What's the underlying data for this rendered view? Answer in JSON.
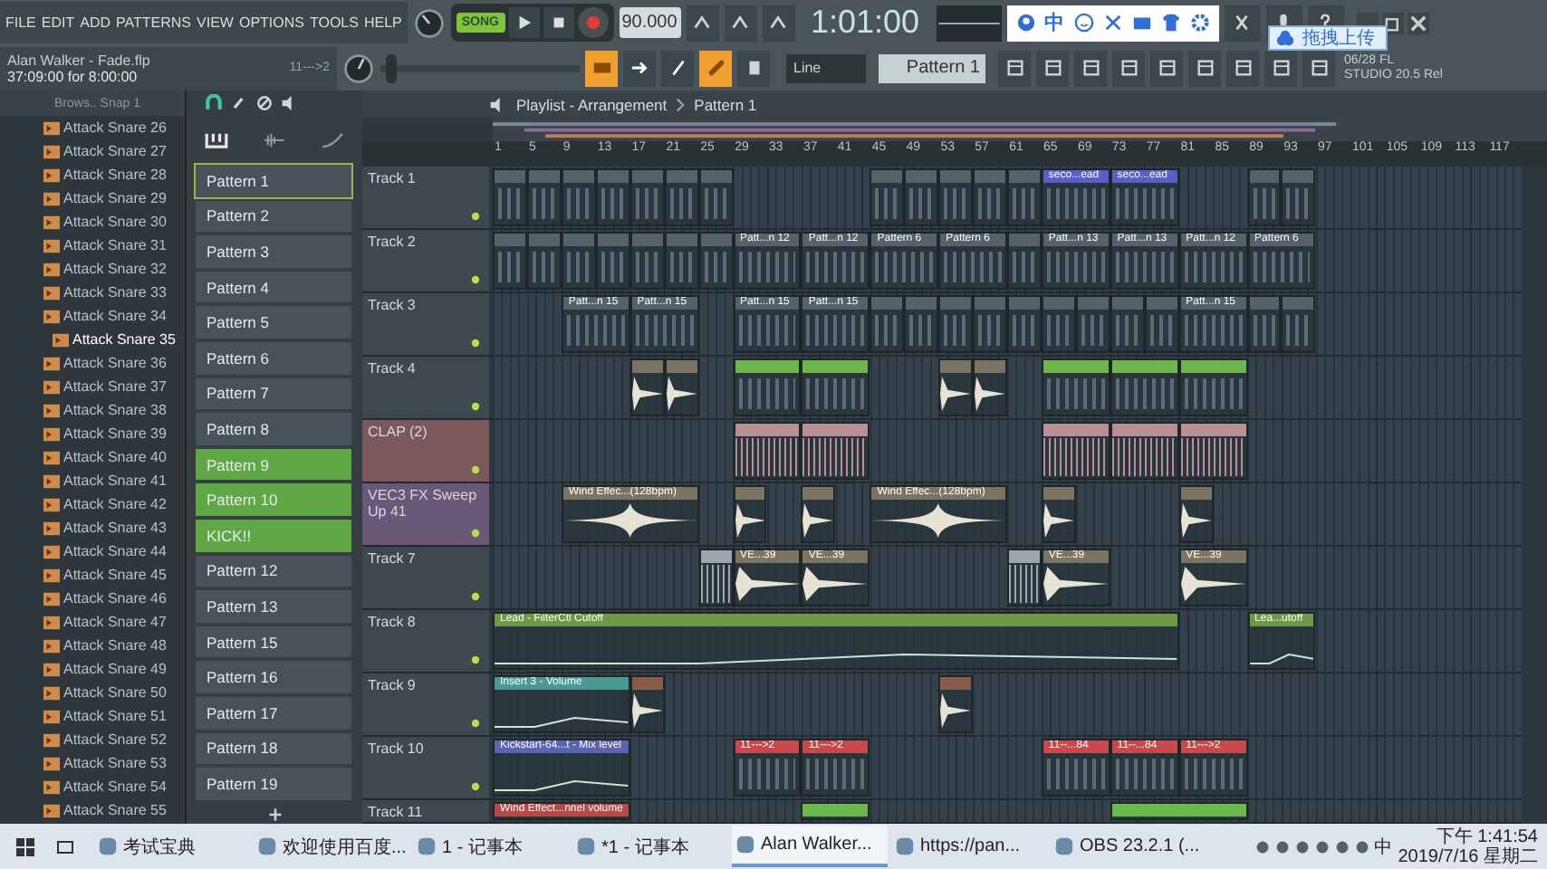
{
  "menu": [
    "FILE",
    "EDIT",
    "ADD",
    "PATTERNS",
    "VIEW",
    "OPTIONS",
    "TOOLS",
    "HELP"
  ],
  "song_info": {
    "title": "Alan Walker - Fade.flp",
    "position": "37:09:00 for 8:00:00",
    "hint": "11--->2"
  },
  "transport": {
    "mode": "SONG"
  },
  "tempo": "90.000",
  "time": "1:01:00",
  "pitch_slider": {
    "level": 0.03
  },
  "snap": "Line",
  "pattern_selector": "Pattern 1",
  "ime_toolbar": {
    "label": "中"
  },
  "upload_tooltip": "拖拽上传",
  "version": {
    "date": "06/28",
    "product": "FL",
    "build": "STUDIO 20.5 Rel"
  },
  "browser": {
    "header": "Brows.. Snap 1",
    "items": [
      {
        "label": "Attack Snare 26",
        "selected": false
      },
      {
        "label": "Attack Snare 27",
        "selected": false
      },
      {
        "label": "Attack Snare 28",
        "selected": false
      },
      {
        "label": "Attack Snare 29",
        "selected": false
      },
      {
        "label": "Attack Snare 30",
        "selected": false
      },
      {
        "label": "Attack Snare 31",
        "selected": false
      },
      {
        "label": "Attack Snare 32",
        "selected": false
      },
      {
        "label": "Attack Snare 33",
        "selected": false
      },
      {
        "label": "Attack Snare 34",
        "selected": false
      },
      {
        "label": "Attack Snare 35",
        "selected": true
      },
      {
        "label": "Attack Snare 36",
        "selected": false
      },
      {
        "label": "Attack Snare 37",
        "selected": false
      },
      {
        "label": "Attack Snare 38",
        "selected": false
      },
      {
        "label": "Attack Snare 39",
        "selected": false
      },
      {
        "label": "Attack Snare 40",
        "selected": false
      },
      {
        "label": "Attack Snare 41",
        "selected": false
      },
      {
        "label": "Attack Snare 42",
        "selected": false
      },
      {
        "label": "Attack Snare 43",
        "selected": false
      },
      {
        "label": "Attack Snare 44",
        "selected": false
      },
      {
        "label": "Attack Snare 45",
        "selected": false
      },
      {
        "label": "Attack Snare 46",
        "selected": false
      },
      {
        "label": "Attack Snare 47",
        "selected": false
      },
      {
        "label": "Attack Snare 48",
        "selected": false
      },
      {
        "label": "Attack Snare 49",
        "selected": false
      },
      {
        "label": "Attack Snare 50",
        "selected": false
      },
      {
        "label": "Attack Snare 51",
        "selected": false
      },
      {
        "label": "Attack Snare 52",
        "selected": false
      },
      {
        "label": "Attack Snare 53",
        "selected": false
      },
      {
        "label": "Attack Snare 54",
        "selected": false
      },
      {
        "label": "Attack Snare 55",
        "selected": false
      }
    ]
  },
  "patterns": [
    {
      "label": "Pattern 1",
      "selected": true,
      "color": "#48525a"
    },
    {
      "label": "Pattern 2",
      "selected": false,
      "color": "#48525a"
    },
    {
      "label": "Pattern 3",
      "selected": false,
      "color": "#48525a"
    },
    {
      "label": "Pattern 4",
      "selected": false,
      "color": "#48525a"
    },
    {
      "label": "Pattern 5",
      "selected": false,
      "color": "#48525a"
    },
    {
      "label": "Pattern 6",
      "selected": false,
      "color": "#48525a"
    },
    {
      "label": "Pattern 7",
      "selected": false,
      "color": "#48525a"
    },
    {
      "label": "Pattern 8",
      "selected": false,
      "color": "#48525a"
    },
    {
      "label": "Pattern 9",
      "selected": false,
      "color": "#5fa845"
    },
    {
      "label": "Pattern 10",
      "selected": false,
      "color": "#5fa845"
    },
    {
      "label": "KICK!!",
      "selected": false,
      "color": "#5fa845"
    },
    {
      "label": "Pattern 12",
      "selected": false,
      "color": "#48525a"
    },
    {
      "label": "Pattern 13",
      "selected": false,
      "color": "#48525a"
    },
    {
      "label": "Pattern 15",
      "selected": false,
      "color": "#48525a"
    },
    {
      "label": "Pattern 16",
      "selected": false,
      "color": "#48525a"
    },
    {
      "label": "Pattern 17",
      "selected": false,
      "color": "#48525a"
    },
    {
      "label": "Pattern 18",
      "selected": false,
      "color": "#48525a"
    },
    {
      "label": "Pattern 19",
      "selected": false,
      "color": "#48525a"
    }
  ],
  "playlist": {
    "title": "Playlist - Arrangement",
    "pattern": "Pattern 1",
    "ruler": [
      "1",
      "5",
      "9",
      "13",
      "17",
      "21",
      "25",
      "29",
      "33",
      "37",
      "41",
      "45",
      "49",
      "53",
      "57",
      "61",
      "65",
      "69",
      "73",
      "77",
      "81",
      "85",
      "89",
      "93",
      "97",
      "101",
      "105",
      "109",
      "113",
      "117"
    ],
    "tracks": [
      {
        "name": "Track 1",
        "color": "#3f484e",
        "cells": [
          {
            "kind": "pattern"
          },
          {
            "kind": "pattern"
          },
          {
            "kind": "pattern"
          },
          {
            "kind": "pattern"
          },
          {
            "kind": "pattern"
          },
          {
            "kind": "pattern"
          },
          {
            "kind": "pattern"
          },
          {
            "kind": "gap"
          },
          {
            "kind": "gap"
          },
          {
            "kind": "gap"
          },
          {
            "kind": "gap"
          },
          {
            "kind": "pattern"
          },
          {
            "kind": "pattern"
          },
          {
            "kind": "pattern"
          },
          {
            "kind": "pattern"
          },
          {
            "kind": "pattern"
          },
          {
            "kind": "pattern",
            "label": "seco...ead",
            "color": "#5a5fc8"
          },
          {
            "kind": "continue"
          },
          {
            "kind": "pattern",
            "label": "seco...ead",
            "color": "#5a5fc8"
          },
          {
            "kind": "continue"
          },
          {
            "kind": "gap"
          },
          {
            "kind": "gap"
          },
          {
            "kind": "pattern"
          },
          {
            "kind": "pattern"
          }
        ]
      },
      {
        "name": "Track 2",
        "color": "#3f484e",
        "cells": [
          {
            "kind": "pattern"
          },
          {
            "kind": "pattern"
          },
          {
            "kind": "pattern"
          },
          {
            "kind": "pattern"
          },
          {
            "kind": "pattern"
          },
          {
            "kind": "pattern"
          },
          {
            "kind": "pattern"
          },
          {
            "kind": "pattern",
            "label": "Patt...n 12"
          },
          {
            "kind": "continue"
          },
          {
            "kind": "pattern",
            "label": "Patt...n 12"
          },
          {
            "kind": "continue"
          },
          {
            "kind": "pattern",
            "label": "Pattern 6"
          },
          {
            "kind": "continue"
          },
          {
            "kind": "pattern",
            "label": "Pattern 6"
          },
          {
            "kind": "continue"
          },
          {
            "kind": "pattern"
          },
          {
            "kind": "pattern",
            "label": "Patt...n 13"
          },
          {
            "kind": "continue"
          },
          {
            "kind": "pattern",
            "label": "Patt...n 13"
          },
          {
            "kind": "continue"
          },
          {
            "kind": "pattern",
            "label": "Patt...n 12"
          },
          {
            "kind": "continue"
          },
          {
            "kind": "pattern",
            "label": "Pattern 6"
          },
          {
            "kind": "continue"
          }
        ]
      },
      {
        "name": "Track 3",
        "color": "#3f484e",
        "cells": [
          {
            "kind": "gap"
          },
          {
            "kind": "gap"
          },
          {
            "kind": "pattern",
            "label": "Patt...n 15"
          },
          {
            "kind": "continue"
          },
          {
            "kind": "pattern",
            "label": "Patt...n 15"
          },
          {
            "kind": "continue"
          },
          {
            "kind": "gap"
          },
          {
            "kind": "pattern",
            "label": "Patt...n 15"
          },
          {
            "kind": "continue"
          },
          {
            "kind": "pattern",
            "label": "Patt...n 15"
          },
          {
            "kind": "continue"
          },
          {
            "kind": "pattern"
          },
          {
            "kind": "pattern"
          },
          {
            "kind": "pattern"
          },
          {
            "kind": "pattern"
          },
          {
            "kind": "pattern"
          },
          {
            "kind": "pattern"
          },
          {
            "kind": "pattern"
          },
          {
            "kind": "pattern"
          },
          {
            "kind": "pattern"
          },
          {
            "kind": "pattern",
            "label": "Patt...n 15"
          },
          {
            "kind": "continue"
          },
          {
            "kind": "pattern"
          },
          {
            "kind": "pattern"
          }
        ]
      },
      {
        "name": "Track 4",
        "color": "#3f484e",
        "cells": [
          {
            "kind": "gap"
          },
          {
            "kind": "gap"
          },
          {
            "kind": "gap"
          },
          {
            "kind": "gap"
          },
          {
            "kind": "sample"
          },
          {
            "kind": "sample"
          },
          {
            "kind": "gap"
          },
          {
            "kind": "pattern",
            "color": "#6cb84a"
          },
          {
            "kind": "continue"
          },
          {
            "kind": "pattern",
            "color": "#6cb84a"
          },
          {
            "kind": "continue"
          },
          {
            "kind": "gap"
          },
          {
            "kind": "gap"
          },
          {
            "kind": "sample"
          },
          {
            "kind": "sample"
          },
          {
            "kind": "gap"
          },
          {
            "kind": "pattern",
            "color": "#6cb84a"
          },
          {
            "kind": "continue"
          },
          {
            "kind": "pattern",
            "color": "#6cb84a"
          },
          {
            "kind": "continue"
          },
          {
            "kind": "pattern",
            "color": "#6cb84a"
          },
          {
            "kind": "continue"
          }
        ]
      },
      {
        "name": "CLAP (2)",
        "color": "#7a585c",
        "cells": [
          {
            "kind": "gap"
          },
          {
            "kind": "gap"
          },
          {
            "kind": "gap"
          },
          {
            "kind": "gap"
          },
          {
            "kind": "gap"
          },
          {
            "kind": "gap"
          },
          {
            "kind": "gap"
          },
          {
            "kind": "dense",
            "color": "#b98f96"
          },
          {
            "kind": "continue"
          },
          {
            "kind": "dense",
            "color": "#b98f96"
          },
          {
            "kind": "continue"
          },
          {
            "kind": "gap"
          },
          {
            "kind": "gap"
          },
          {
            "kind": "gap"
          },
          {
            "kind": "gap"
          },
          {
            "kind": "gap"
          },
          {
            "kind": "dense",
            "color": "#b98f96"
          },
          {
            "kind": "continue"
          },
          {
            "kind": "dense",
            "color": "#b98f96"
          },
          {
            "kind": "continue"
          },
          {
            "kind": "dense",
            "color": "#b98f96"
          },
          {
            "kind": "continue"
          }
        ]
      },
      {
        "name": "VEC3 FX Sweep Up 41",
        "color": "#6a5878",
        "cells": [
          {
            "kind": "gap"
          },
          {
            "kind": "gap"
          },
          {
            "kind": "swell",
            "label": "Wind Effec...(128bpm)"
          },
          {
            "kind": "continue"
          },
          {
            "kind": "continue"
          },
          {
            "kind": "continue"
          },
          {
            "kind": "gap"
          },
          {
            "kind": "sample"
          },
          {
            "kind": "gap"
          },
          {
            "kind": "sample"
          },
          {
            "kind": "gap"
          },
          {
            "kind": "swell",
            "label": "Wind Effec...(128bpm)"
          },
          {
            "kind": "continue"
          },
          {
            "kind": "continue"
          },
          {
            "kind": "continue"
          },
          {
            "kind": "gap"
          },
          {
            "kind": "sample"
          },
          {
            "kind": "gap"
          },
          {
            "kind": "gap"
          },
          {
            "kind": "gap"
          },
          {
            "kind": "sample"
          }
        ]
      },
      {
        "name": "Track 7",
        "color": "#3f484e",
        "cells": [
          {
            "kind": "gap"
          },
          {
            "kind": "gap"
          },
          {
            "kind": "gap"
          },
          {
            "kind": "gap"
          },
          {
            "kind": "gap"
          },
          {
            "kind": "gap"
          },
          {
            "kind": "dense",
            "color": "#9aa7ae"
          },
          {
            "kind": "sample",
            "label": "VE...39"
          },
          {
            "kind": "continue"
          },
          {
            "kind": "sample",
            "label": "VE...39"
          },
          {
            "kind": "continue"
          },
          {
            "kind": "gap"
          },
          {
            "kind": "gap"
          },
          {
            "kind": "gap"
          },
          {
            "kind": "gap"
          },
          {
            "kind": "dense",
            "color": "#9aa7ae"
          },
          {
            "kind": "sample",
            "label": "VE...39"
          },
          {
            "kind": "continue"
          },
          {
            "kind": "gap"
          },
          {
            "kind": "gap"
          },
          {
            "kind": "sample",
            "label": "VE...39"
          },
          {
            "kind": "continue"
          }
        ]
      },
      {
        "name": "Track 8",
        "color": "#3f484e",
        "cells": [
          {
            "kind": "automation",
            "label": "Lead - FilterCtl Cutoff",
            "color": "#6e9a48"
          },
          {
            "kind": "continue"
          },
          {
            "kind": "continue"
          },
          {
            "kind": "continue"
          },
          {
            "kind": "continue"
          },
          {
            "kind": "continue"
          },
          {
            "kind": "continue"
          },
          {
            "kind": "continue"
          },
          {
            "kind": "continue"
          },
          {
            "kind": "continue"
          },
          {
            "kind": "continue"
          },
          {
            "kind": "continue"
          },
          {
            "kind": "continue"
          },
          {
            "kind": "continue"
          },
          {
            "kind": "continue"
          },
          {
            "kind": "continue"
          },
          {
            "kind": "continue"
          },
          {
            "kind": "continue"
          },
          {
            "kind": "continue"
          },
          {
            "kind": "continue"
          },
          {
            "kind": "gap"
          },
          {
            "kind": "gap"
          },
          {
            "kind": "automation",
            "label": "Lea...utoff",
            "color": "#6e9a48"
          },
          {
            "kind": "continue"
          }
        ]
      },
      {
        "name": "Track 9",
        "color": "#3f484e",
        "cells": [
          {
            "kind": "automation",
            "label": "Insert 3 - Volume",
            "color": "#4a9a94"
          },
          {
            "kind": "continue"
          },
          {
            "kind": "continue"
          },
          {
            "kind": "continue"
          },
          {
            "kind": "sample",
            "color": "#8a5a4a"
          },
          {
            "kind": "gap"
          },
          {
            "kind": "gap"
          },
          {
            "kind": "gap"
          },
          {
            "kind": "gap"
          },
          {
            "kind": "gap"
          },
          {
            "kind": "gap"
          },
          {
            "kind": "gap"
          },
          {
            "kind": "gap"
          },
          {
            "kind": "sample",
            "color": "#8a5a4a"
          }
        ]
      },
      {
        "name": "Track 10",
        "color": "#3f484e",
        "cells": [
          {
            "kind": "automation",
            "label": "Kickstart-64...t - Mix level",
            "color": "#5a64b0"
          },
          {
            "kind": "continue"
          },
          {
            "kind": "continue"
          },
          {
            "kind": "continue"
          },
          {
            "kind": "gap"
          },
          {
            "kind": "gap"
          },
          {
            "kind": "gap"
          },
          {
            "kind": "pattern",
            "label": "11--->2",
            "color": "#c9484a"
          },
          {
            "kind": "continue"
          },
          {
            "kind": "pattern",
            "label": "11--->2",
            "color": "#c9484a"
          },
          {
            "kind": "continue"
          },
          {
            "kind": "gap"
          },
          {
            "kind": "gap"
          },
          {
            "kind": "gap"
          },
          {
            "kind": "gap"
          },
          {
            "kind": "gap"
          },
          {
            "kind": "pattern",
            "label": "11--...84",
            "color": "#c9484a"
          },
          {
            "kind": "continue"
          },
          {
            "kind": "pattern",
            "label": "11--...84",
            "color": "#c9484a"
          },
          {
            "kind": "continue"
          },
          {
            "kind": "pattern",
            "label": "11--->2",
            "color": "#c9484a"
          },
          {
            "kind": "continue"
          }
        ]
      },
      {
        "name": "Track 11",
        "color": "#3f484e",
        "cells": [
          {
            "kind": "automation",
            "label": "Wind Effect...nnel volume",
            "color": "#b84848"
          },
          {
            "kind": "continue"
          },
          {
            "kind": "continue"
          },
          {
            "kind": "continue"
          },
          {
            "kind": "gap"
          },
          {
            "kind": "gap"
          },
          {
            "kind": "gap"
          },
          {
            "kind": "gap"
          },
          {
            "kind": "gap"
          },
          {
            "kind": "pattern",
            "color": "#6cb84a"
          },
          {
            "kind": "continue"
          },
          {
            "kind": "gap"
          },
          {
            "kind": "gap"
          },
          {
            "kind": "gap"
          },
          {
            "kind": "gap"
          },
          {
            "kind": "gap"
          },
          {
            "kind": "gap"
          },
          {
            "kind": "gap"
          },
          {
            "kind": "pattern",
            "color": "#6cb84a"
          },
          {
            "kind": "continue"
          },
          {
            "kind": "continue"
          },
          {
            "kind": "continue"
          }
        ]
      }
    ]
  },
  "taskbar": {
    "items": [
      {
        "label": "考试宝典",
        "selected": false
      },
      {
        "label": "欢迎使用百度...",
        "selected": false
      },
      {
        "label": "1 - 记事本",
        "selected": false
      },
      {
        "label": "*1 - 记事本",
        "selected": false
      },
      {
        "label": "Alan Walker...",
        "selected": true
      },
      {
        "label": "https://pan...",
        "selected": false
      },
      {
        "label": "OBS 23.2.1 (...",
        "selected": false
      }
    ],
    "ime": "中",
    "time": "下午 1:41:54",
    "date": "2019/7/16 星期二"
  }
}
